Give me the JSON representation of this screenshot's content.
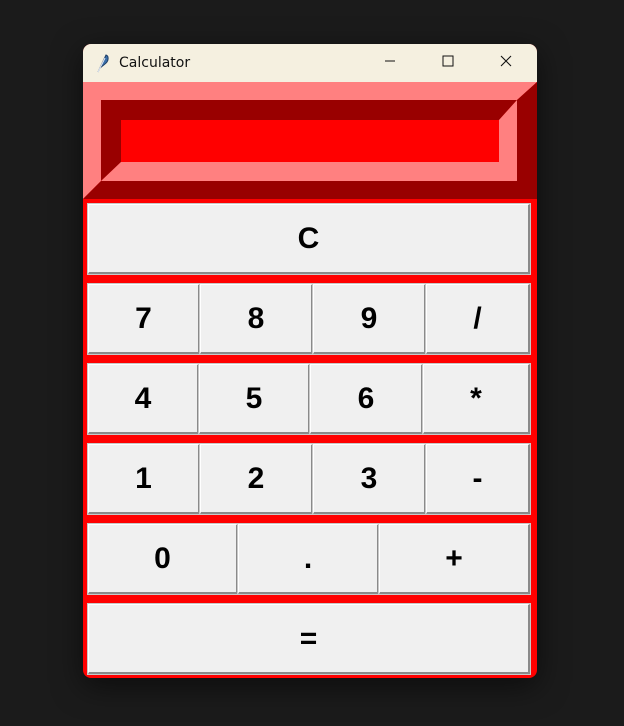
{
  "window": {
    "title": "Calculator"
  },
  "display": {
    "value": ""
  },
  "keypad": {
    "clear": "C",
    "row1": [
      "7",
      "8",
      "9",
      "/"
    ],
    "row2": [
      "4",
      "5",
      "6",
      "*"
    ],
    "row3": [
      "1",
      "2",
      "3",
      "-"
    ],
    "row4": [
      "0",
      ".",
      "+"
    ],
    "equals": "="
  },
  "colors": {
    "accent": "#ff0000",
    "bevel_light": "#ff8080",
    "bevel_dark": "#990000",
    "button_face": "#f0f0f0",
    "titlebar": "#f5f0e0",
    "desktop": "#1b1b1b"
  },
  "icons": {
    "app": "feather-icon",
    "minimize": "minimize-icon",
    "maximize": "maximize-icon",
    "close": "close-icon"
  }
}
